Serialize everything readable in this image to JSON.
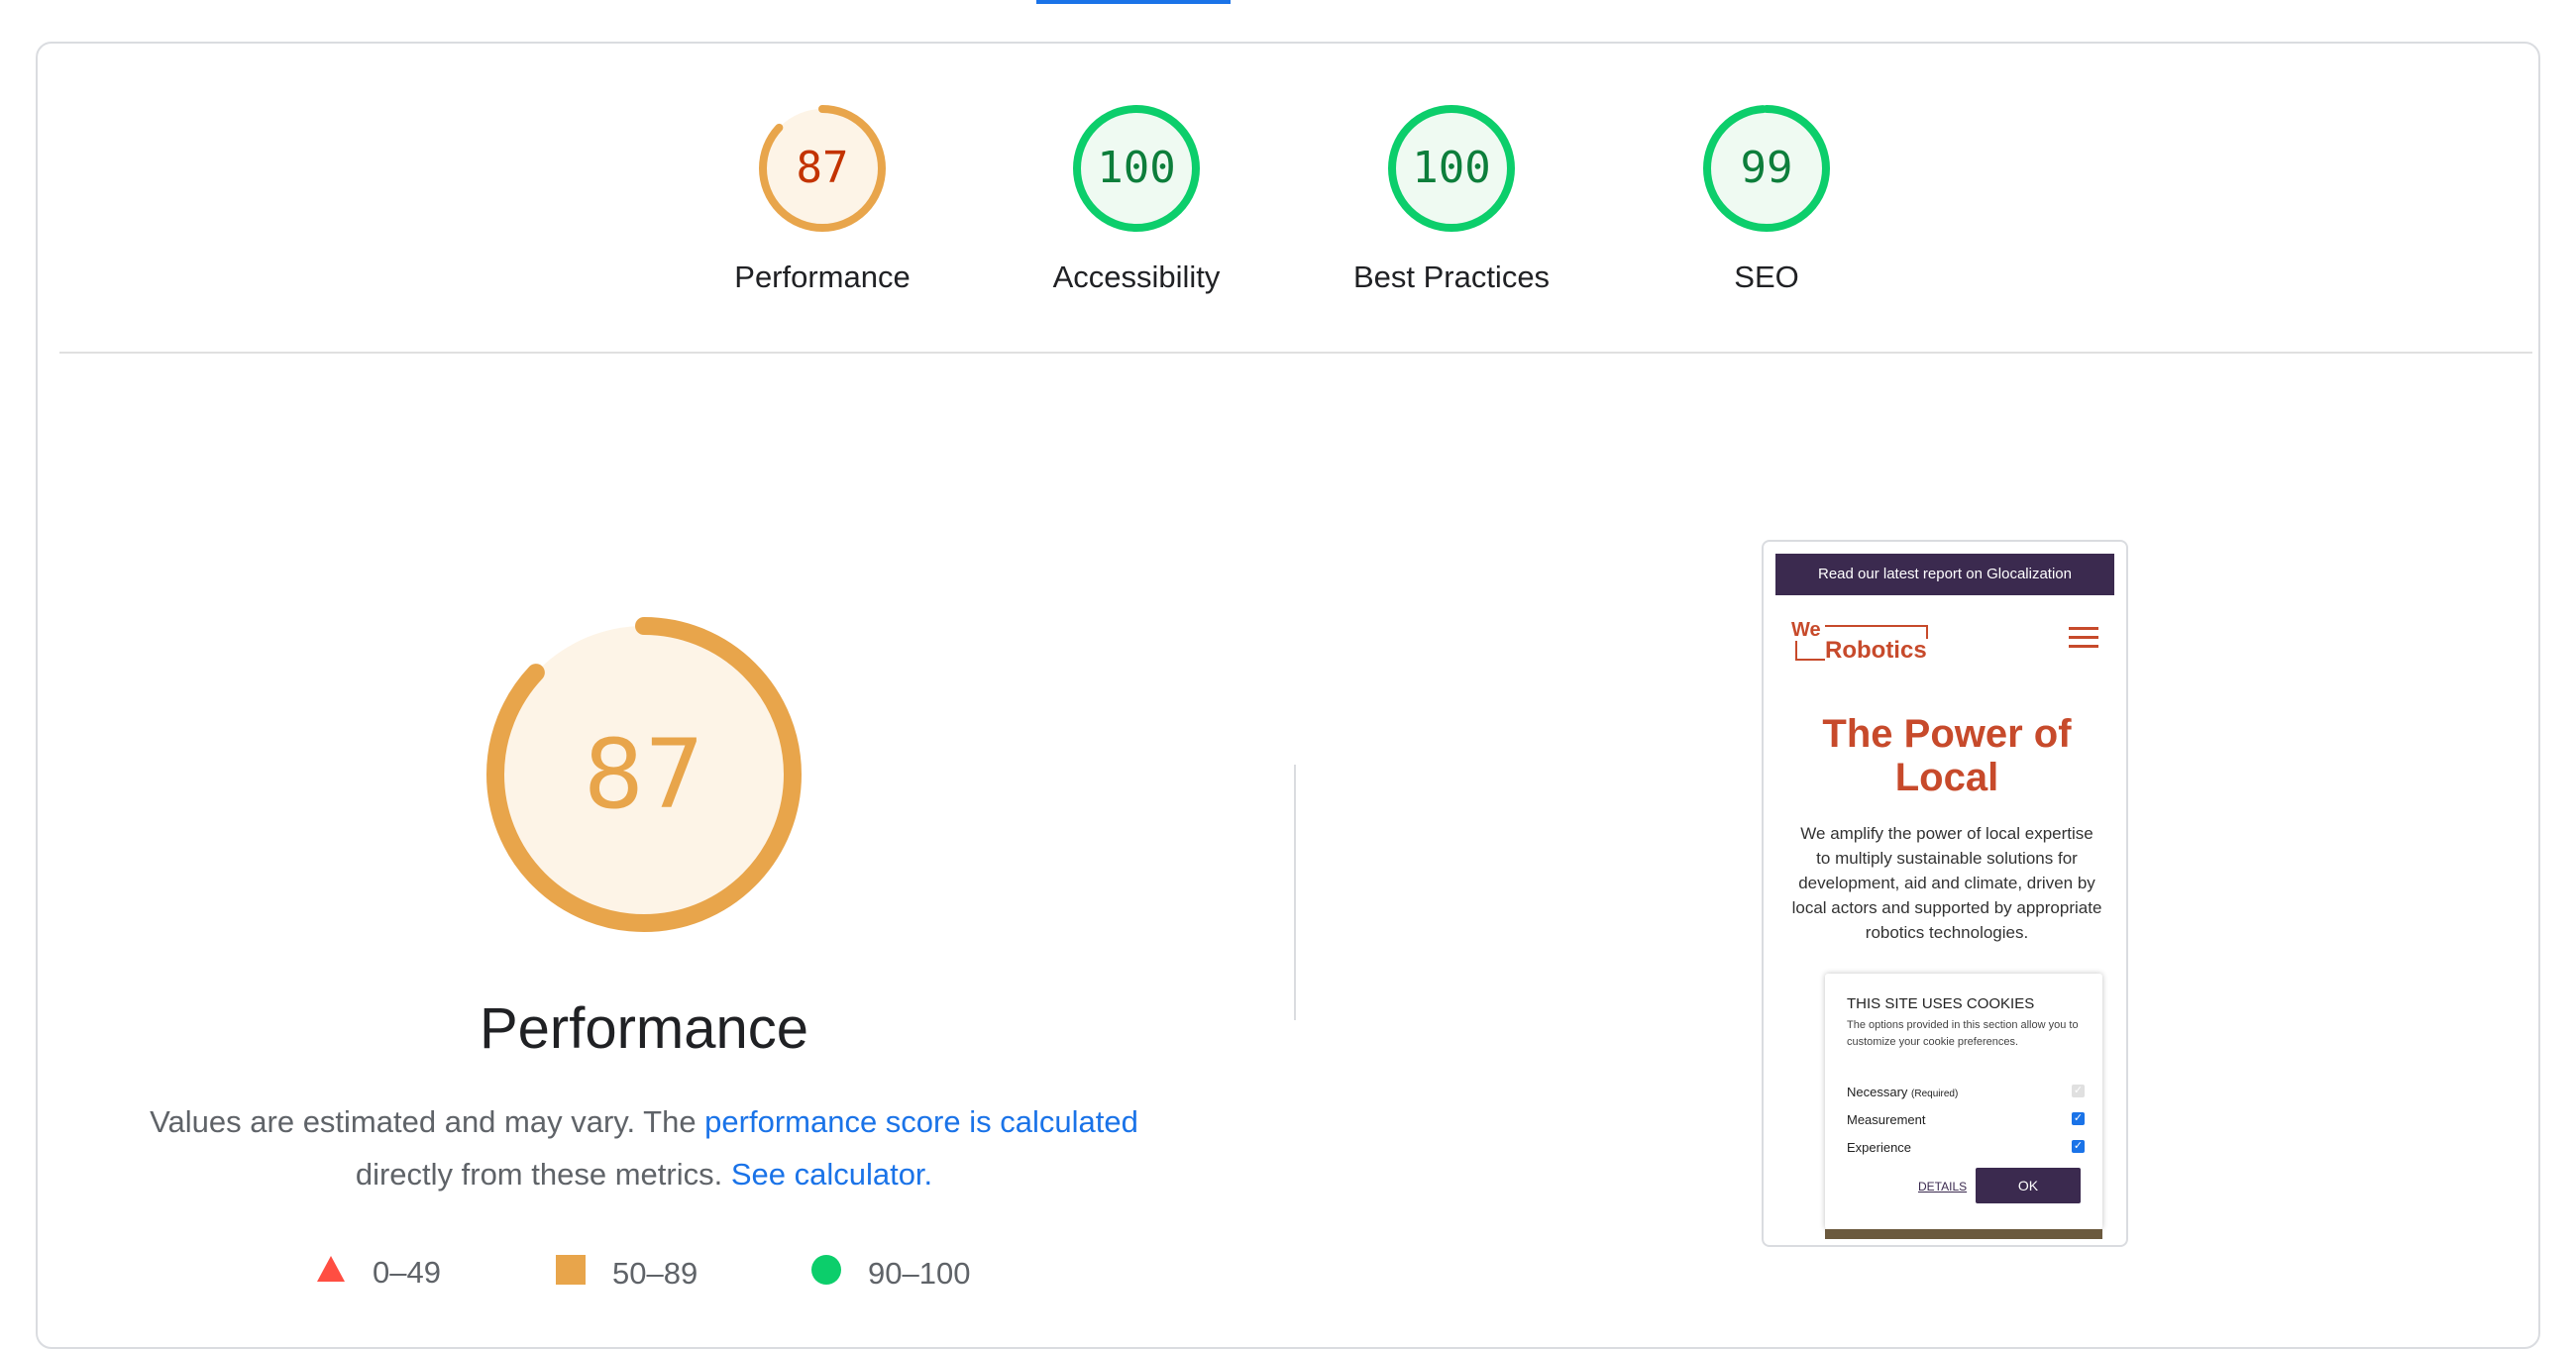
{
  "colors": {
    "average": "#e8a54b",
    "average_dark": "#c33300",
    "pass": "#0cce6b",
    "pass_dark": "#0d7e3b",
    "fail": "#ff4e42",
    "link": "#1a73e8"
  },
  "categories": [
    {
      "id": "performance",
      "label": "Performance",
      "score": "87",
      "value": 0.87,
      "rating": "average"
    },
    {
      "id": "accessibility",
      "label": "Accessibility",
      "score": "100",
      "value": 1.0,
      "rating": "pass"
    },
    {
      "id": "best-practices",
      "label": "Best Practices",
      "score": "100",
      "value": 1.0,
      "rating": "pass"
    },
    {
      "id": "seo",
      "label": "SEO",
      "score": "99",
      "value": 0.99,
      "rating": "pass"
    }
  ],
  "performance": {
    "score": "87",
    "value": 0.87,
    "title": "Performance",
    "desc_prefix": "Values are estimated and may vary. The ",
    "desc_link": "performance score is calculated",
    "desc_middle": " directly from these metrics. ",
    "calc_link": "See calculator."
  },
  "legend": [
    {
      "shape": "triangle",
      "range": "0–49",
      "color": "#ff4e42"
    },
    {
      "shape": "square",
      "range": "50–89",
      "color": "#e8a54b"
    },
    {
      "shape": "circle",
      "range": "90–100",
      "color": "#0cce6b"
    }
  ],
  "screenshot": {
    "banner": "Read our latest report on Glocalization",
    "logo_we": "We",
    "logo_robotics": "Robotics",
    "hero_title": "The Power of Local",
    "hero_text": "We amplify the power of local expertise to multiply sustainable solutions for development, aid and climate, driven by local actors and supported by appropriate robotics technologies.",
    "cookie": {
      "title": "THIS SITE USES COOKIES",
      "desc": "The options provided in this section allow you to customize your cookie preferences.",
      "necessary": "Necessary",
      "required": "(Required)",
      "measurement": "Measurement",
      "experience": "Experience",
      "details": "DETAILS",
      "ok": "OK"
    }
  }
}
